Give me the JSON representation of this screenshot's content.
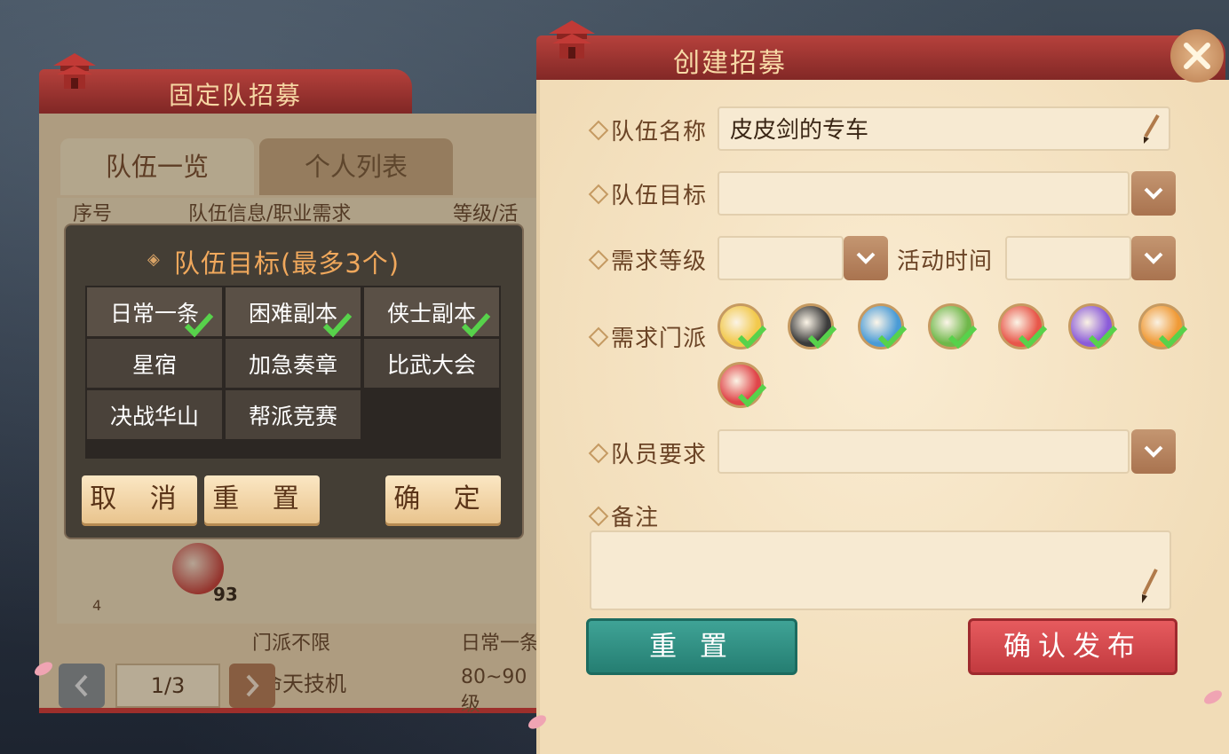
{
  "left_panel": {
    "title": "固定队招募",
    "tabs": [
      {
        "label": "队伍一览",
        "active": true
      },
      {
        "label": "个人列表",
        "active": false
      }
    ],
    "columns": [
      "序号",
      "队伍信息/职业需求",
      "等级/活"
    ],
    "row_fragments": [
      "门派不限",
      "日常一条",
      "命天技机",
      "80~90级"
    ],
    "avatar_level": "93",
    "row_number": "4",
    "pager": {
      "page": "1/3"
    }
  },
  "target_popup": {
    "title": "队伍目标(最多3个)",
    "options": [
      {
        "label": "日常一条",
        "selected": true
      },
      {
        "label": "困难副本",
        "selected": true
      },
      {
        "label": "侠士副本",
        "selected": true
      },
      {
        "label": "星宿",
        "selected": false
      },
      {
        "label": "加急奏章",
        "selected": false
      },
      {
        "label": "比武大会",
        "selected": false
      },
      {
        "label": "决战华山",
        "selected": false
      },
      {
        "label": "帮派竞赛",
        "selected": false
      }
    ],
    "buttons": {
      "cancel": "取 消",
      "reset": "重 置",
      "confirm": "确 定"
    }
  },
  "create_panel": {
    "title": "创建招募",
    "team_name_label": "队伍名称",
    "team_name_value": "皮皮剑的专车",
    "team_target_label": "队伍目标",
    "team_target_value": "",
    "level_label": "需求等级",
    "level_value": "",
    "time_label": "活动时间",
    "time_value": "",
    "sect_label": "需求门派",
    "sects": [
      {
        "name": "sect-1",
        "color": "#f2c94c",
        "checked": true
      },
      {
        "name": "sect-2",
        "color": "#3b3b3b",
        "checked": true
      },
      {
        "name": "sect-3",
        "color": "#4a9bd6",
        "checked": true
      },
      {
        "name": "sect-4",
        "color": "#6fb84a",
        "checked": true
      },
      {
        "name": "sect-5",
        "color": "#e8574a",
        "checked": true
      },
      {
        "name": "sect-6",
        "color": "#8b5cd9",
        "checked": true
      },
      {
        "name": "sect-7",
        "color": "#f09a36",
        "checked": true
      },
      {
        "name": "sect-8",
        "color": "#e0464a",
        "checked": true
      }
    ],
    "member_req_label": "队员要求",
    "member_req_value": "",
    "note_label": "备注",
    "note_value": "",
    "reset_button": "重 置",
    "publish_button": "确认发布"
  },
  "colors": {
    "accent_red": "#9e2a2e",
    "teal": "#2a8a7c",
    "parchment": "#f6e6c8"
  }
}
